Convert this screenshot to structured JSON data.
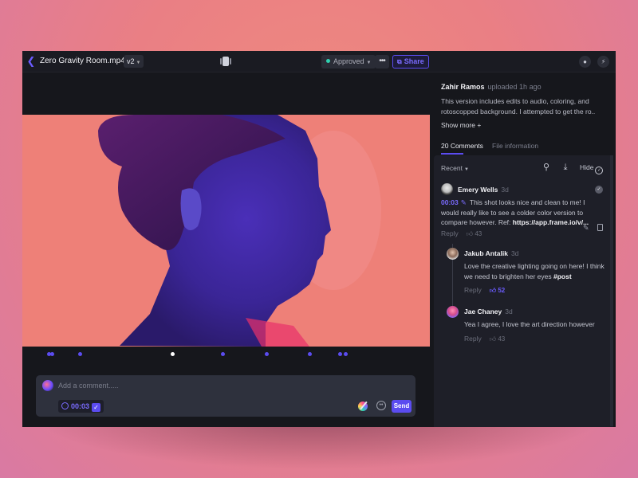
{
  "header": {
    "back_icon": "chevron-left-icon",
    "file_title": "Zero Gravity Room.mp4",
    "version": "v2",
    "compare_icon": "compare-versions-icon",
    "status": "Approved",
    "status_color": "#2fd1b0",
    "more_label": "•••",
    "share_label": "Share",
    "share_icon": "share-icon",
    "user_icon": "user-icon",
    "bolt_icon": "lightning-icon"
  },
  "player": {
    "image": "portrait of woman in profile under blue/purple light on coral background",
    "timeline_markers": [
      {
        "position": 0.065,
        "active": false
      },
      {
        "position": 0.072,
        "active": false
      },
      {
        "position": 0.14,
        "active": false
      },
      {
        "position": 0.365,
        "active": true
      },
      {
        "position": 0.487,
        "active": false
      },
      {
        "position": 0.594,
        "active": false
      },
      {
        "position": 0.699,
        "active": false
      },
      {
        "position": 0.773,
        "active": false
      },
      {
        "position": 0.786,
        "active": false
      }
    ],
    "accent_color": "#5b4cf0"
  },
  "composer": {
    "placeholder": "Add a comment.....",
    "timecode": "00:03",
    "send_label": "Send",
    "draw_icon": "annotate-brush-icon",
    "emoji_icon": "emoji-icon"
  },
  "sidebar": {
    "uploader": "Zahir Ramos",
    "uploaded_time": "uploaded 1h ago",
    "description": "This version includes edits to audio, coloring, and rotoscopped background. I attempted to get the ro..",
    "show_more": "Show more +",
    "tabs": [
      {
        "label": "20 Comments",
        "active": true
      },
      {
        "label": "File information",
        "active": false
      }
    ],
    "sort_label": "Recent",
    "hide_label": "Hide",
    "comments": [
      {
        "author": "Emery Wells",
        "time": "3d",
        "timecode": "00:03",
        "text": "This shot looks nice and clean to me! I would really like to see a colder color version to compare however. Ref: ",
        "link": "https://app.frame.io/v/...",
        "reply_label": "Reply",
        "likes": "43"
      },
      {
        "author": "Jakub Antalik",
        "time": "3d",
        "text": "Love the creative lighting going on here! I think we need to brighten her eyes ",
        "tag": "#post",
        "reply_label": "Reply",
        "likes": "52"
      },
      {
        "author": "Jae Chaney",
        "time": "3d",
        "text": "Yea I agree, I love the art direction however",
        "reply_label": "Reply",
        "likes": "43"
      }
    ]
  }
}
